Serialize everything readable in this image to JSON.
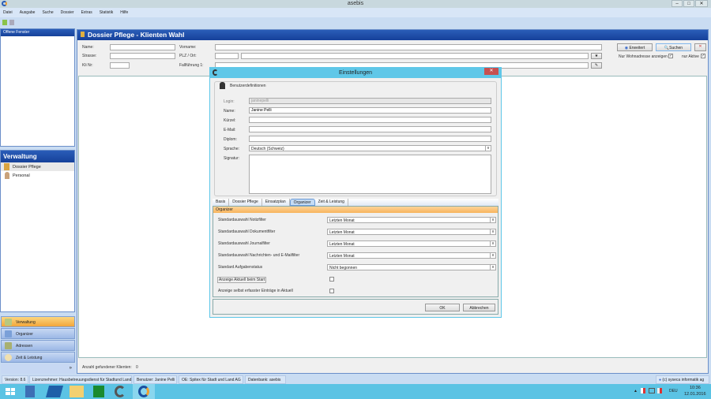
{
  "app": {
    "title": "asebis",
    "window_controls": [
      "minimize",
      "maximize",
      "close"
    ]
  },
  "menu": [
    "Datei",
    "Ausgabe",
    "Suche",
    "Dossier",
    "Extras",
    "Statistik",
    "Hilfe"
  ],
  "left": {
    "open_windows_title": "Offene Fenster",
    "section_title": "Verwaltung",
    "section_items": [
      {
        "label": "Dossier Pflege",
        "icon": "dossier-icon"
      },
      {
        "label": "Personal",
        "icon": "person-icon"
      }
    ],
    "nav": [
      {
        "label": "Verwaltung",
        "active": true
      },
      {
        "label": "Organizer"
      },
      {
        "label": "Adressen"
      },
      {
        "label": "Zeit & Leistung"
      }
    ],
    "more": "»"
  },
  "main": {
    "title": "Dossier Pflege - Klienten Wahl",
    "labels": {
      "name": "Name:",
      "strasse": "Strasse:",
      "kl_nr": "Kli Nr:",
      "vorname": "Vorname:",
      "plz_ort": "PLZ / Ort:",
      "fallfuehrung": "Fallführung 1:"
    },
    "buttons": {
      "erweitert": "Erweitert",
      "suchen": "Suchen"
    },
    "checks": [
      {
        "label": "Nur Wohnadresse anzeigen",
        "checked": true
      },
      {
        "label": "nur Aktive",
        "checked": true
      }
    ],
    "count_label": "Anzahl gefundener Klienten:",
    "count": "0"
  },
  "dialog": {
    "title": "Einstellungen",
    "group": "Benutzerdefinitionen",
    "fields": [
      {
        "label": "Login:",
        "value": "janinepelli",
        "disabled": true
      },
      {
        "label": "Name:",
        "value": "Janine Pelli"
      },
      {
        "label": "Kürzel:",
        "value": ""
      },
      {
        "label": "E-Mail:",
        "value": ""
      },
      {
        "label": "Diplom:",
        "value": ""
      }
    ],
    "sprache_label": "Sprache:",
    "sprache": "Deutsch (Schweiz)",
    "signatur_label": "Signatur:",
    "tabs": [
      "Basis",
      "Dossier Pflege",
      "Einsatzplan",
      "Organizer",
      "Zeit & Leistung"
    ],
    "active_tab": "Organizer",
    "section": "Organizer",
    "rows": [
      {
        "label": "Standardauswahl Notizfilter",
        "value": "Letzten Monat"
      },
      {
        "label": "Standardauswahl Dokumentfilter",
        "value": "Letzten Monat"
      },
      {
        "label": "Standardauswahl Journalfilter",
        "value": "Letzten Monat"
      },
      {
        "label": "Standardauswahl Nachrichten- und E-Mailfilter",
        "value": "Letzten Monat"
      },
      {
        "label": "Standard Aufgabenstatus",
        "value": "Nicht begonnen"
      }
    ],
    "checks": [
      {
        "label": "Anzeige Aktuell beim Start",
        "checked": false
      },
      {
        "label": "Anzeige selbst erfasster Einträge in Aktuell",
        "checked": false
      }
    ],
    "ok": "OK",
    "cancel": "Abbrechen"
  },
  "status": {
    "version": "Version: 8.6",
    "lizenz": "Lizenznehmer: Hausbetreuungsdienst für Stadtund Land",
    "benutzer": "Benutzer: Janine Pelli",
    "oe": "OE: Spitex für Stadt und Land AG",
    "db": "Datenbank: asebis",
    "copyright": "(c) syseca informatik ag"
  },
  "taskbar": {
    "lang": "DEU",
    "time": "10:36",
    "date": "12.01.2016"
  },
  "colors": {
    "header": "#1e4ea8",
    "active_nav": "#f5b041",
    "dialog_title": "#5fc7e8",
    "organizer_bar": "#fbc27a",
    "taskbar": "#5bc3e4"
  }
}
